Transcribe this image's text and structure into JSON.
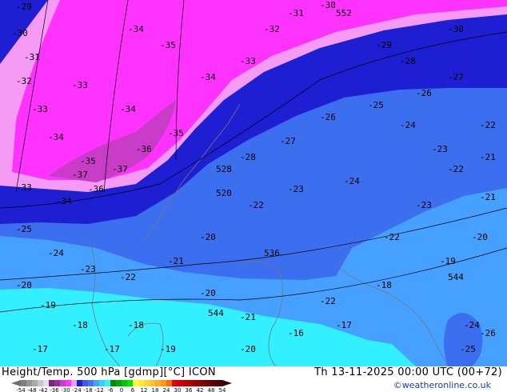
{
  "header": {
    "title": "Height/Temp. 500 hPa [gdmp][°C] ICON",
    "valid_time": "Th 13-11-2025 00:00 UTC (00+72)",
    "credit": "©weatheronline.co.uk"
  },
  "colorbar": {
    "ticks": [
      "-54",
      "-48",
      "-42",
      "-36",
      "-30",
      "-24",
      "-18",
      "-12",
      "-6",
      "0",
      "6",
      "12",
      "18",
      "24",
      "30",
      "36",
      "42",
      "48",
      "54"
    ],
    "colors": [
      "#808080",
      "#969696",
      "#aaaaaa",
      "#c8c8c8",
      "#e1e1e1",
      "#78287a",
      "#a028a0",
      "#c83cc8",
      "#ff32ff",
      "#f59bf5",
      "#1e1ed2",
      "#3c5af0",
      "#3c78f5",
      "#46a0ff",
      "#32d2ff",
      "#32f0ff",
      "#008c00",
      "#00aa00",
      "#00c800",
      "#00e600",
      "#ffff32",
      "#ffeb32",
      "#ffd732",
      "#ffc332",
      "#ffaf1e",
      "#ff961e",
      "#ff6e00",
      "#e60000",
      "#d20000",
      "#be0000",
      "#aa0000",
      "#960000",
      "#820000",
      "#6e0000",
      "#5a0000",
      "#460000"
    ]
  },
  "map": {
    "region_colors": {
      "cyan": "#32f0ff",
      "light_blue": "#46a0ff",
      "medium_blue": "#3c6ef0",
      "dark_blue": "#1e1ed2",
      "pink": "#f59bf5",
      "magenta": "#ff32ff",
      "purple": "#c83cc8"
    },
    "contour_labels": [
      "-29",
      "-30",
      "-31",
      "-32",
      "-33",
      "-34",
      "-35",
      "-34",
      "-35",
      "-34",
      "-33",
      "-32",
      "-31",
      "-30",
      "-33",
      "-34",
      "-35",
      "-36",
      "-37",
      "-37",
      "-36",
      "-34",
      "-33",
      "-28",
      "-27",
      "-26",
      "-25",
      "-24",
      "-23",
      "-22",
      "-21",
      "-20",
      "-19",
      "-18",
      "-17",
      "-16",
      "-25",
      "-24",
      "-23",
      "-22",
      "-21",
      "-20",
      "-22",
      "-23",
      "-24",
      "-26",
      "-27",
      "-28",
      "-29",
      "-30",
      "-22",
      "-21",
      "-20",
      "-19",
      "-18",
      "-17",
      "-20",
      "-21",
      "-22",
      "-24",
      "-25",
      "-26",
      "-23",
      "-22",
      "-20",
      "-19",
      "-18",
      "-17",
      "528",
      "536",
      "544",
      "544",
      "552",
      "520"
    ]
  }
}
